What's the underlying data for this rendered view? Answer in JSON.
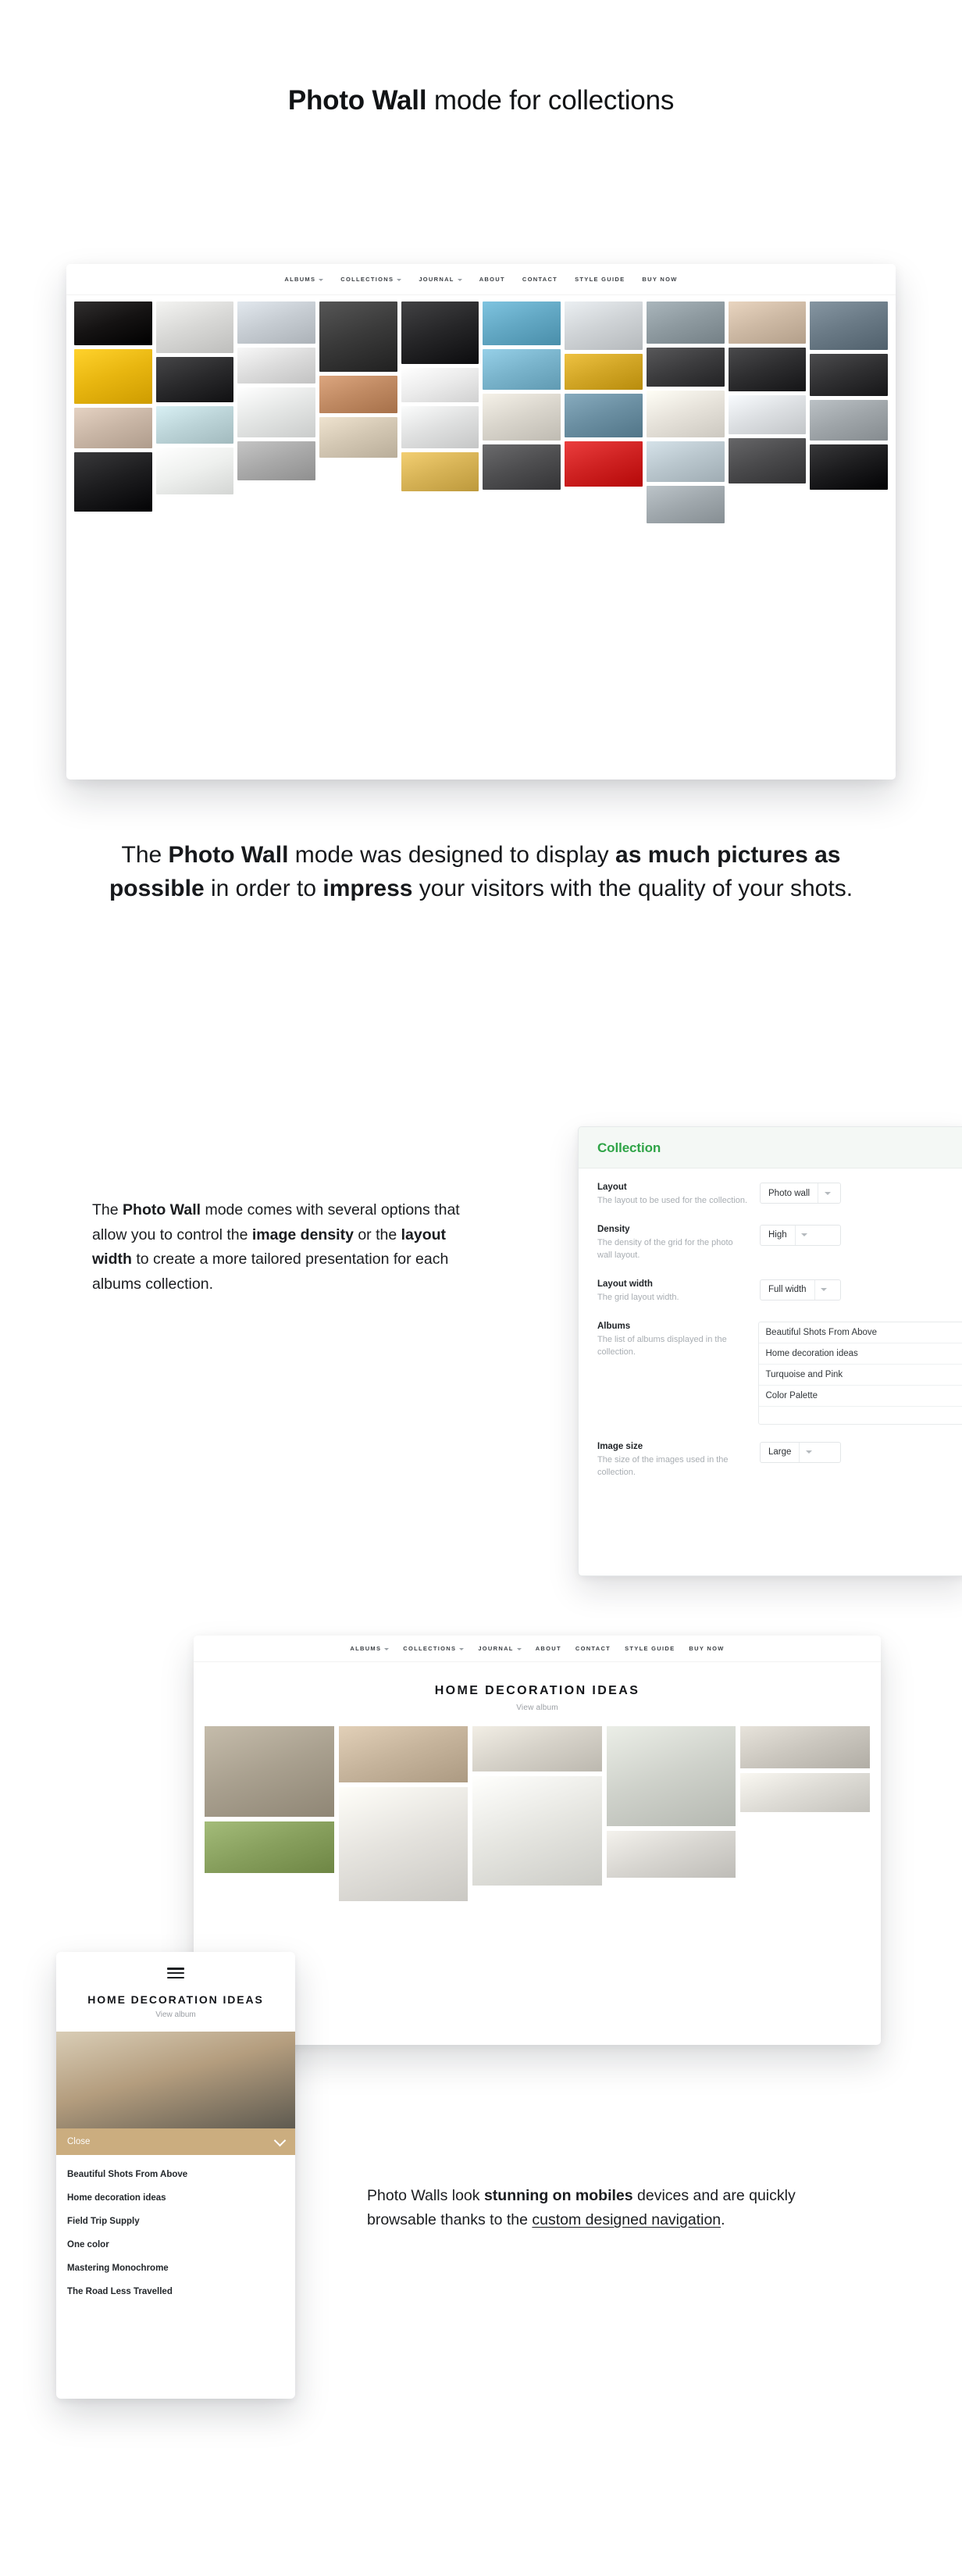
{
  "page": {
    "title_prefix": "Photo Wall",
    "title_rest": " mode for collections"
  },
  "lead_paragraph": {
    "p1": "The ",
    "b1": "Photo Wall",
    "p2": " mode was designed to display ",
    "b2": "as much pictures as possible",
    "p3": " in order to ",
    "b3": "impress",
    "p4": " your visitors with the quality of your shots."
  },
  "site_nav": {
    "items": [
      {
        "label": "ALBUMS",
        "caret": true
      },
      {
        "label": "COLLECTIONS",
        "caret": true
      },
      {
        "label": "JOURNAL",
        "caret": true
      },
      {
        "label": "ABOUT",
        "caret": false
      },
      {
        "label": "CONTACT",
        "caret": false
      },
      {
        "label": "STYLE GUIDE",
        "caret": false
      },
      {
        "label": "BUY NOW",
        "caret": false
      }
    ]
  },
  "options_copy": {
    "p1": "The ",
    "b1": "Photo Wall",
    "p2": " mode comes with several options that allow you to control the ",
    "b2": "image density",
    "p3": " or the ",
    "b3": "layout width",
    "p4": " to create a more tailored presentation for each albums collection."
  },
  "settings_panel": {
    "heading": "Collection",
    "heading_color": "#2fa447",
    "fields": [
      {
        "name": "Layout",
        "description": "The layout to be used for the collection.",
        "value": "Photo wall",
        "control": "select"
      },
      {
        "name": "Density",
        "description": "The density of the grid for the photo wall layout.",
        "value": "High",
        "control": "select"
      },
      {
        "name": "Layout width",
        "description": "The grid layout width.",
        "value": "Full width",
        "control": "select"
      },
      {
        "name": "Albums",
        "description": "The list of albums displayed in the collection.",
        "control": "list",
        "items": [
          "Beautiful Shots From Above",
          "Home decoration ideas",
          "Turquoise and Pink",
          "Color Palette"
        ]
      },
      {
        "name": "Image size",
        "description": "The size of the images used in the collection.",
        "value": "Large",
        "control": "select"
      }
    ]
  },
  "album_page": {
    "title": "HOME DECORATION IDEAS",
    "subtitle": "View album"
  },
  "mobile": {
    "title": "HOME DECORATION IDEAS",
    "subtitle": "View album",
    "close_label": "Close",
    "close_bar_color": "#cbad7f",
    "nav_items": [
      "Beautiful Shots From Above",
      "Home decoration ideas",
      "Field Trip Supply",
      "One color",
      "Mastering Monochrome",
      "The Road Less Travelled"
    ]
  },
  "mobile_copy": {
    "p1": "Photo Walls look ",
    "b1": "stunning on mobiles",
    "p2": " devices and are quickly browsable thanks to the ",
    "u1": "custom designed navigation",
    "p3": "."
  },
  "photo_wall": {
    "tiles": [
      {
        "h": 56,
        "c": "#151313",
        "k": "portrait-dark"
      },
      {
        "h": 70,
        "c": "#e8b610",
        "k": "pug-yellow"
      },
      {
        "h": 52,
        "c": "#c9b6a6",
        "k": "hall-interior"
      },
      {
        "h": 76,
        "c": "#1d1d1f",
        "k": "bw-couple"
      },
      {
        "h": 66,
        "c": "#d8d8d6",
        "k": "bw-texture"
      },
      {
        "h": 58,
        "c": "#2a2a2c",
        "k": "bw-surf"
      },
      {
        "h": 48,
        "c": "#bcd4d8",
        "k": "cupcakes"
      },
      {
        "h": 60,
        "c": "#eef0ee",
        "k": "white-shelf"
      },
      {
        "h": 54,
        "c": "#c6ccd2",
        "k": "architecture"
      },
      {
        "h": 46,
        "c": "#dcdcdc",
        "k": "bw-water-poles"
      },
      {
        "h": 64,
        "c": "#e4e6e5",
        "k": "bride-back"
      },
      {
        "h": 50,
        "c": "#a9a9a9",
        "k": "bw-stripes"
      },
      {
        "h": 90,
        "c": "#3a3a3a",
        "k": "wedding-kiss"
      },
      {
        "h": 48,
        "c": "#c08a63",
        "k": "canyon-jump"
      },
      {
        "h": 52,
        "c": "#d3c7b3",
        "k": "table-setting"
      },
      {
        "h": 80,
        "c": "#262628",
        "k": "black-jacket"
      },
      {
        "h": 44,
        "c": "#ebebeb",
        "k": "bw-bridge"
      },
      {
        "h": 54,
        "c": "#dfe0e0",
        "k": "bw-portrait2"
      },
      {
        "h": 50,
        "c": "#d7b356",
        "k": "gold-slab"
      },
      {
        "h": 56,
        "c": "#63a8c4",
        "k": "wave-blue"
      },
      {
        "h": 52,
        "c": "#7ab4cc",
        "k": "ice-walker"
      },
      {
        "h": 60,
        "c": "#d9d5cc",
        "k": "trumpet"
      },
      {
        "h": 58,
        "c": "#4e4e50",
        "k": "bw-man-smoke"
      },
      {
        "h": 62,
        "c": "#cfd3d6",
        "k": "street-window"
      },
      {
        "h": 46,
        "c": "#d2a626",
        "k": "gold-pyramid"
      },
      {
        "h": 56,
        "c": "#6b8fa2",
        "k": "sky-climb"
      },
      {
        "h": 58,
        "c": "#cf2222",
        "k": "pug-red"
      },
      {
        "h": 54,
        "c": "#8e9aa0",
        "k": "mountain-bw"
      },
      {
        "h": 50,
        "c": "#3c3c3e",
        "k": "bw-portrait3"
      },
      {
        "h": 60,
        "c": "#e6e2da",
        "k": "bouquet"
      },
      {
        "h": 52,
        "c": "#b9c6cd",
        "k": "interior-light"
      },
      {
        "h": 48,
        "c": "#a0a8ad",
        "k": "bw-urban"
      },
      {
        "h": 54,
        "c": "#cdb9a4",
        "k": "flower-crown"
      },
      {
        "h": 56,
        "c": "#2e2e30",
        "k": "bw-suit"
      },
      {
        "h": 50,
        "c": "#dcdfe2",
        "k": "bw-building"
      },
      {
        "h": 58,
        "c": "#4a4a4c",
        "k": "bw-dance"
      },
      {
        "h": 62,
        "c": "#6a7a86",
        "k": "skyline"
      },
      {
        "h": 54,
        "c": "#303032",
        "k": "man-coat"
      },
      {
        "h": 52,
        "c": "#9fa5a9",
        "k": "bw-car"
      },
      {
        "h": 58,
        "c": "#1c1c1e",
        "k": "bw-face"
      }
    ]
  },
  "album_wall": {
    "tiles": [
      {
        "h": 116,
        "c": "#a9a08f",
        "k": "dining-room"
      },
      {
        "h": 66,
        "c": "#88a05e",
        "k": "living-green"
      },
      {
        "h": 72,
        "c": "#c6b49c",
        "k": "bedroom-desk"
      },
      {
        "h": 146,
        "c": "#e4e2dd",
        "k": "white-arch-lamp"
      },
      {
        "h": 58,
        "c": "#d6d2c9",
        "k": "sofa-pillow"
      },
      {
        "h": 140,
        "c": "#e6e6e1",
        "k": "shelf-clock"
      },
      {
        "h": 128,
        "c": "#cfd2cb",
        "k": "mirror-plant"
      },
      {
        "h": 60,
        "c": "#d8d6d1",
        "k": "kitchen-lamps"
      },
      {
        "h": 54,
        "c": "#cbc7bf",
        "k": "hall-mirror"
      },
      {
        "h": 50,
        "c": "#dedcd6",
        "k": "corner-plant"
      }
    ]
  }
}
